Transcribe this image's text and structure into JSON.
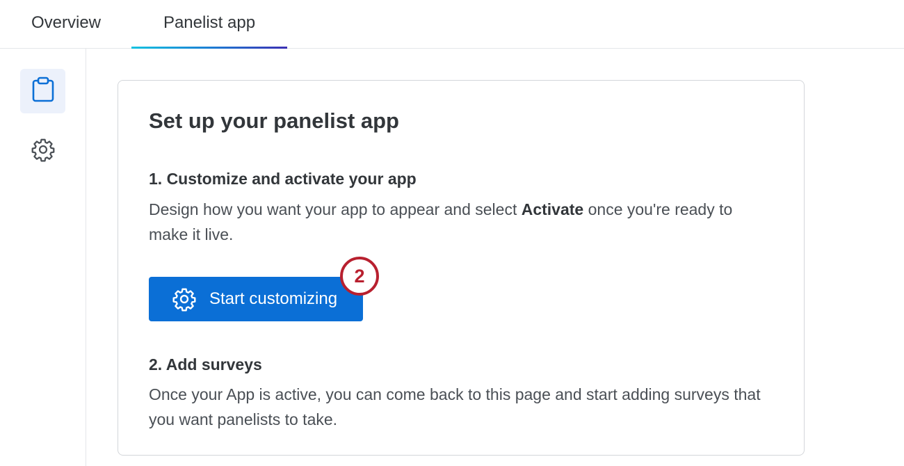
{
  "tabs": [
    {
      "label": "Overview",
      "active": false
    },
    {
      "label": "Panelist app",
      "active": true
    }
  ],
  "sidebar": {
    "items": [
      {
        "icon": "clipboard-icon",
        "active": true
      },
      {
        "icon": "gear-icon",
        "active": false
      }
    ]
  },
  "card": {
    "title": "Set up your panelist app",
    "step1": {
      "title": "1. Customize and activate your app",
      "desc_before": "Design how you want your app to appear and select ",
      "desc_bold": "Activate",
      "desc_after": " once you're ready to make it live."
    },
    "cta": {
      "label": "Start customizing",
      "icon": "gear-icon"
    },
    "callout_badge": "2",
    "step2": {
      "title": "2. Add surveys",
      "desc": "Once your App is active, you can come back to this page and start adding surveys that you want panelists to take."
    }
  },
  "colors": {
    "primary": "#0b6fd6",
    "callout": "#b8202f",
    "tab_gradient": [
      "#16c2e0",
      "#1c7fd4",
      "#3b2fb3"
    ],
    "active_rail": "#ecf1fb"
  }
}
